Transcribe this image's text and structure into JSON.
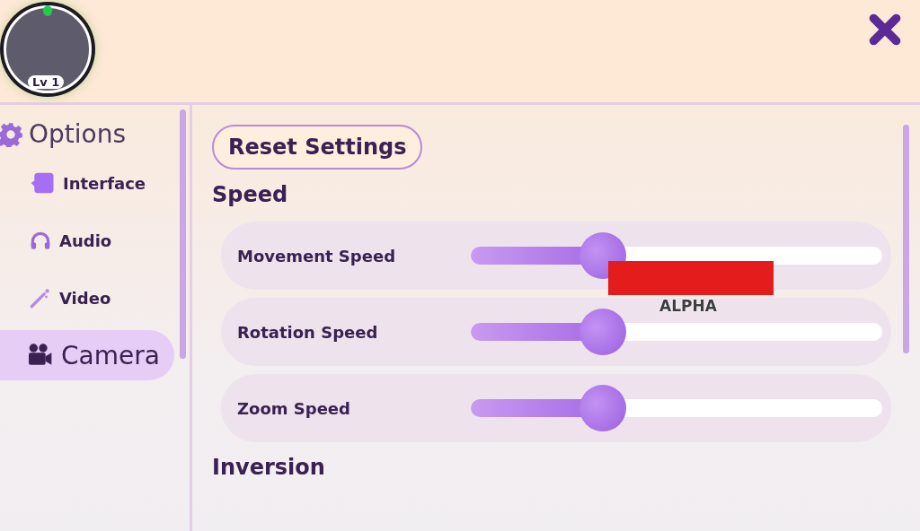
{
  "player": {
    "level_badge": "Lv 1",
    "online": true
  },
  "sidebar": {
    "title": "Options",
    "items": [
      {
        "label": "Interface",
        "kind": "interface",
        "selected": false
      },
      {
        "label": "Audio",
        "kind": "audio",
        "selected": false
      },
      {
        "label": "Video",
        "kind": "video",
        "selected": false
      },
      {
        "label": "Camera",
        "kind": "camera",
        "selected": true
      }
    ]
  },
  "reset_button": "Reset Settings",
  "sections": [
    {
      "title": "Speed",
      "sliders": [
        {
          "label": "Movement Speed",
          "level": 0.32
        },
        {
          "label": "Rotation Speed",
          "level": 0.32
        },
        {
          "label": "Zoom Speed",
          "level": 0.32
        }
      ]
    },
    {
      "title": "Inversion"
    }
  ],
  "overlay": {
    "redacted": true,
    "caption": "ALPHA"
  }
}
